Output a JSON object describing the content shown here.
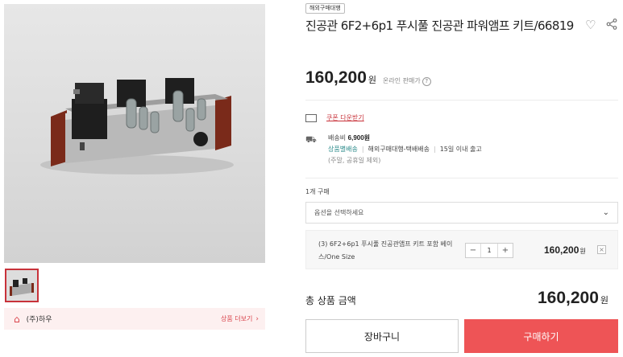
{
  "product": {
    "badge": "해외구매대행",
    "title": "진공관 6F2+6p1 푸시풀 진공관 파워앰프 키트/66819",
    "price": "160,200",
    "currency": "원",
    "price_note": "온라인 판매가",
    "help": "?"
  },
  "seller": {
    "name": "(주)하우",
    "more_link": "상품 더보기"
  },
  "coupon": {
    "label": "쿠폰 다운받기"
  },
  "shipping": {
    "fee_label": "배송비",
    "fee": "6,900원",
    "type": "상품별배송",
    "method": "해외구매대행-택배배송",
    "lead_time": "15일 이내 출고",
    "note": "(주말, 공휴일 제외)"
  },
  "order": {
    "qty_label": "1개 구매",
    "option_placeholder": "옵션을 선택하세요",
    "selected_option": {
      "name": "(3) 6F2+6p1 푸시풀 진공관앰프 키트 포함 베이스/One Size",
      "quantity": "1",
      "price": "160,200",
      "currency": "원"
    },
    "total_label": "총 상품 금액",
    "total": "160,200",
    "total_currency": "원",
    "cart_button": "장바구니",
    "buy_button": "구매하기"
  },
  "colors": {
    "accent": "#ee5456",
    "coupon_red": "#c8323a",
    "shipping_teal": "#2a8a8a"
  },
  "icons": [
    "store-icon",
    "heart-icon",
    "share-icon",
    "coupon-icon",
    "truck-icon",
    "chevron-down-icon",
    "chevron-right-icon"
  ]
}
